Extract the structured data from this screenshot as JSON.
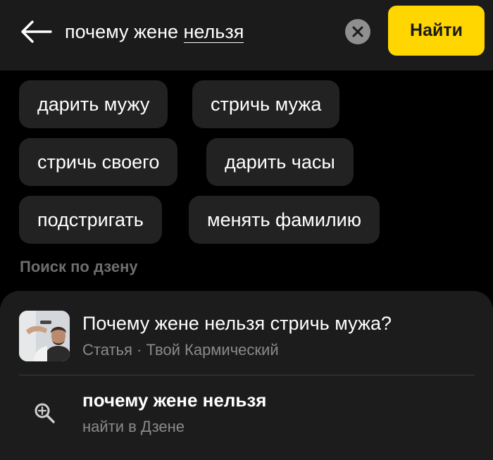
{
  "search": {
    "query_prefix": "почему жене ",
    "query_highlight": "нельзя",
    "back_icon": "arrow-left-icon",
    "clear_icon": "close-icon",
    "find_label": "Найти"
  },
  "suggestions": [
    {
      "label": "дарить мужу"
    },
    {
      "label": "стричь мужа"
    },
    {
      "label": "стричь своего"
    },
    {
      "label": "дарить часы"
    },
    {
      "label": "подстригать"
    },
    {
      "label": "менять фамилию"
    }
  ],
  "section_title": "Поиск по дзену",
  "result": {
    "title": "Почему жене нельзя стричь мужа?",
    "subtitle": "Статья · Твой Кармический",
    "thumbnail_icon": "barber-photo"
  },
  "search_in": {
    "icon": "search-icon",
    "title": "почему жене нельзя",
    "subtitle": "найти в Дзене"
  },
  "colors": {
    "accent": "#ffd600",
    "background": "#000000",
    "header": "#1b1b1b",
    "chip": "#222222",
    "muted_text": "#8a8a8a"
  }
}
